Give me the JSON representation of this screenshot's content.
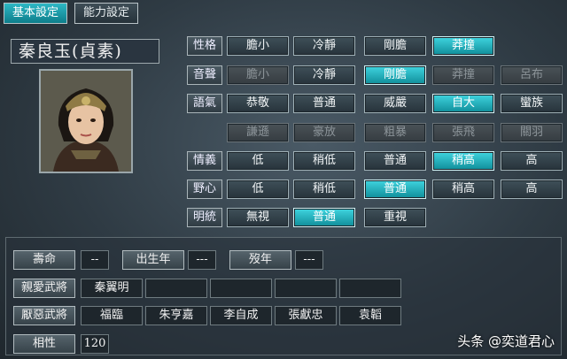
{
  "tabs": [
    "基本設定",
    "能力設定"
  ],
  "general_name": "秦良玉(貞素)",
  "traits": [
    {
      "label": "性格",
      "options": [
        {
          "text": "膽小",
          "state": "normal"
        },
        {
          "text": "冷靜",
          "state": "normal"
        },
        {
          "text": "剛膽",
          "state": "normal"
        },
        {
          "text": "莽撞",
          "state": "selected"
        }
      ]
    },
    {
      "label": "音聲",
      "options": [
        {
          "text": "膽小",
          "state": "disabled"
        },
        {
          "text": "冷靜",
          "state": "normal"
        },
        {
          "text": "剛膽",
          "state": "selected"
        },
        {
          "text": "莽撞",
          "state": "disabled"
        },
        {
          "text": "呂布",
          "state": "disabled"
        }
      ]
    },
    {
      "label": "語氣",
      "options": [
        {
          "text": "恭敬",
          "state": "normal"
        },
        {
          "text": "普通",
          "state": "normal"
        },
        {
          "text": "威嚴",
          "state": "normal"
        },
        {
          "text": "自大",
          "state": "selected"
        },
        {
          "text": "蠻族",
          "state": "normal"
        }
      ]
    },
    {
      "label": "",
      "options": [
        {
          "text": "謙遜",
          "state": "disabled"
        },
        {
          "text": "豪放",
          "state": "disabled"
        },
        {
          "text": "粗暴",
          "state": "disabled"
        },
        {
          "text": "張飛",
          "state": "disabled"
        },
        {
          "text": "關羽",
          "state": "disabled"
        }
      ]
    },
    {
      "label": "情義",
      "options": [
        {
          "text": "低",
          "state": "normal"
        },
        {
          "text": "稍低",
          "state": "normal"
        },
        {
          "text": "普通",
          "state": "normal"
        },
        {
          "text": "稍高",
          "state": "selected"
        },
        {
          "text": "高",
          "state": "normal"
        }
      ]
    },
    {
      "label": "野心",
      "options": [
        {
          "text": "低",
          "state": "normal"
        },
        {
          "text": "稍低",
          "state": "normal"
        },
        {
          "text": "普通",
          "state": "selected"
        },
        {
          "text": "稍高",
          "state": "normal"
        },
        {
          "text": "高",
          "state": "normal"
        }
      ]
    },
    {
      "label": "明統",
      "options": [
        {
          "text": "無視",
          "state": "normal"
        },
        {
          "text": "普通",
          "state": "selected"
        },
        {
          "text": "重視",
          "state": "normal"
        }
      ]
    }
  ],
  "lifespan": {
    "label": "壽命",
    "value": "--"
  },
  "birth_year": {
    "label": "出生年",
    "value": "---"
  },
  "death_year": {
    "label": "歿年",
    "value": "---"
  },
  "close_generals": {
    "label": "親愛武將",
    "names": [
      "秦翼明",
      "",
      "",
      "",
      ""
    ]
  },
  "hated_generals": {
    "label": "厭惡武將",
    "names": [
      "福臨",
      "朱亨嘉",
      "李自成",
      "張獻忠",
      "袁韜"
    ]
  },
  "compatibility": {
    "label": "相性",
    "value": "120"
  },
  "watermark": "头条 @奕道君心",
  "colors": {
    "selected": "#1aa7b3",
    "background": "#2f3b44"
  }
}
